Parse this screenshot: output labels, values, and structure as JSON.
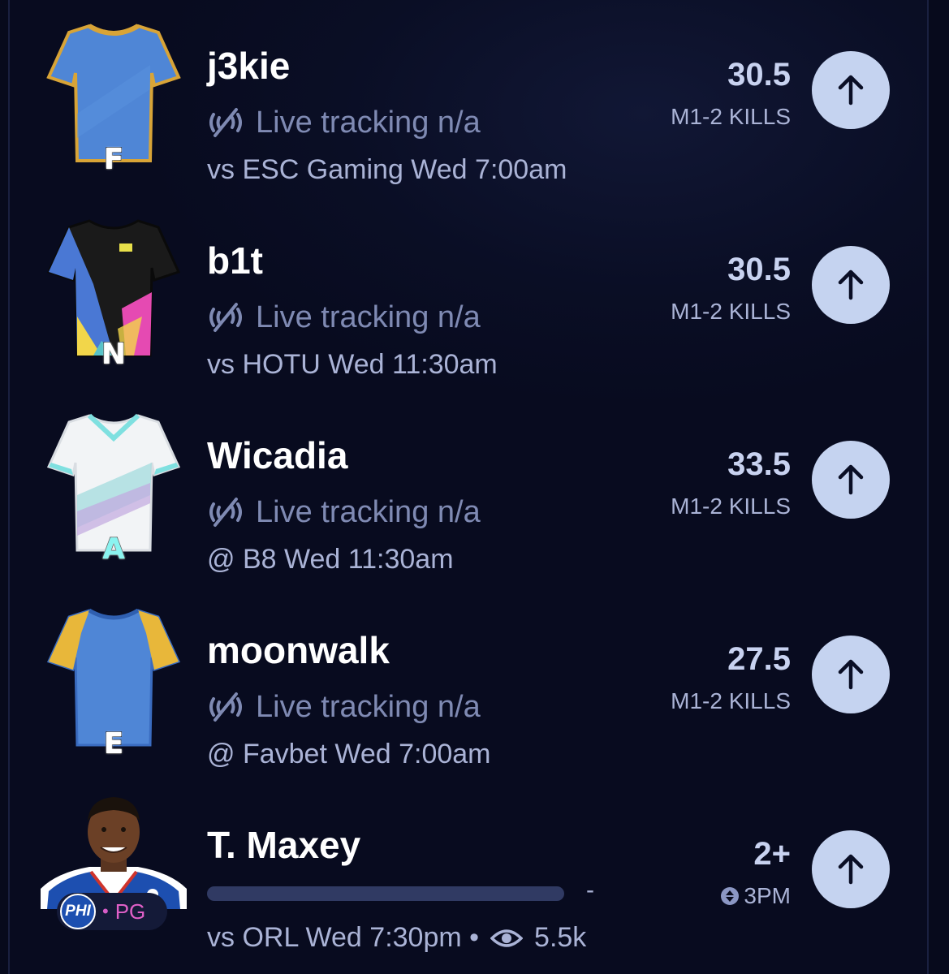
{
  "colors": {
    "background": "#070a1c",
    "text_primary": "#ffffff",
    "text_muted": "#7f8ab3",
    "line_value": "#c8d2f0",
    "button_bg": "#c5d3f0",
    "accent_pink": "#e060c8"
  },
  "players": [
    {
      "name": "j3kie",
      "position": "F",
      "live_tracking": "Live tracking n/a",
      "game": "vs ESC Gaming Wed 7:00am",
      "line": "30.5",
      "stat": "M1-2 KILLS",
      "icon": "jersey-icon",
      "action_icon": "arrow-up-icon"
    },
    {
      "name": "b1t",
      "position": "N",
      "live_tracking": "Live tracking n/a",
      "game": "vs HOTU Wed 11:30am",
      "line": "30.5",
      "stat": "M1-2 KILLS",
      "icon": "jersey-icon",
      "action_icon": "arrow-up-icon"
    },
    {
      "name": "Wicadia",
      "position": "A",
      "live_tracking": "Live tracking n/a",
      "game": "@ B8 Wed 11:30am",
      "line": "33.5",
      "stat": "M1-2 KILLS",
      "icon": "jersey-icon",
      "action_icon": "arrow-up-icon"
    },
    {
      "name": "moonwalk",
      "position": "E",
      "live_tracking": "Live tracking n/a",
      "game": "@ Favbet Wed 7:00am",
      "line": "27.5",
      "stat": "M1-2 KILLS",
      "icon": "jersey-icon",
      "action_icon": "arrow-up-icon"
    },
    {
      "name": "T. Maxey",
      "team": "PHI",
      "position": "PG",
      "separator": "•",
      "progress_dash": "-",
      "progress": 0,
      "game": "vs ORL Wed 7:30pm •",
      "views": "5.5k",
      "line": "2+",
      "time_badge": "3PM",
      "icon": "player-photo",
      "action_icon": "arrow-up-icon"
    }
  ]
}
